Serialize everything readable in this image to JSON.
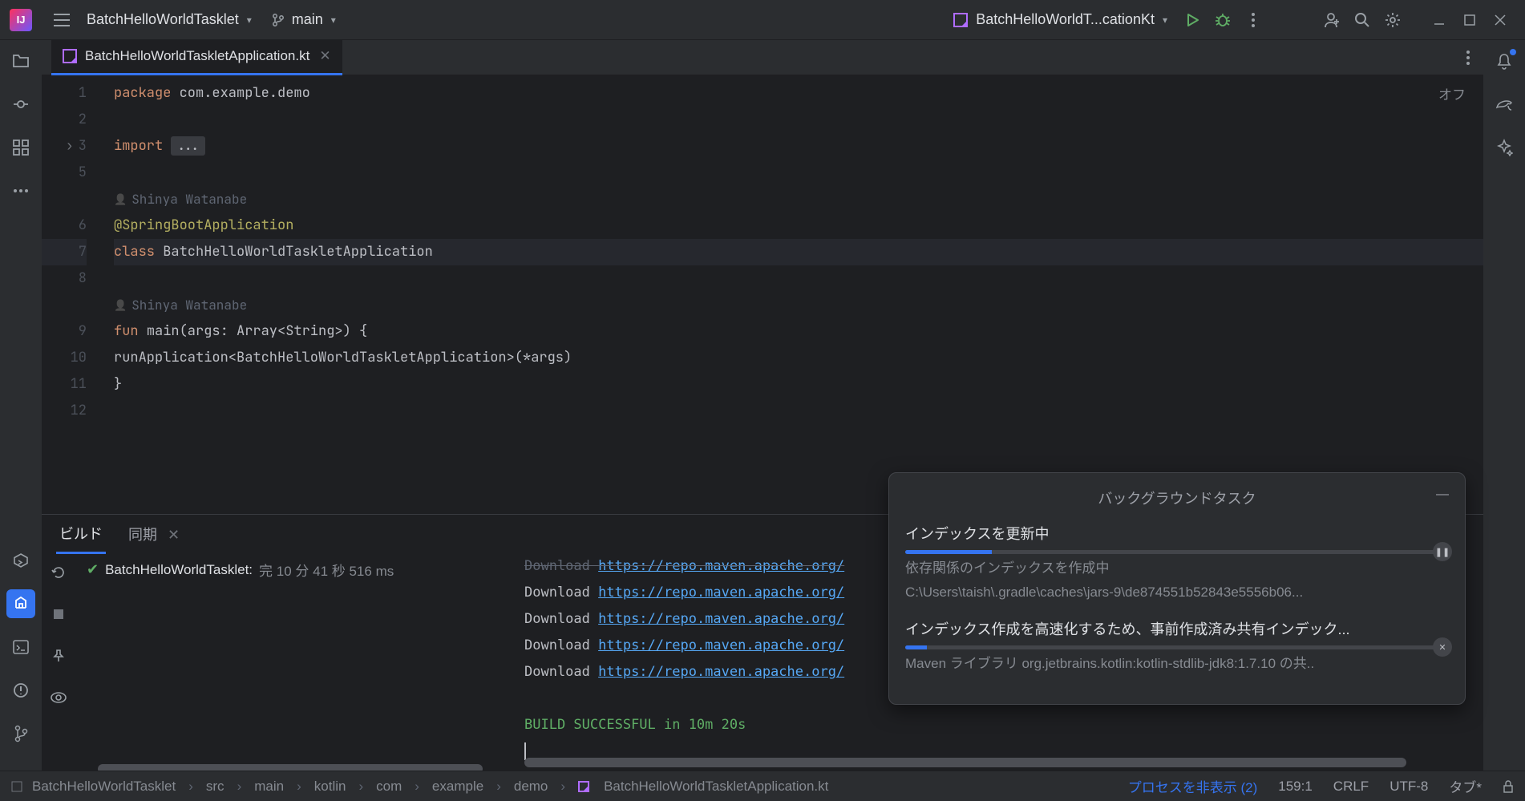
{
  "topbar": {
    "project": "BatchHelloWorldTasklet",
    "branch": "main",
    "run_config": "BatchHelloWorldT...cationKt"
  },
  "tab": {
    "filename": "BatchHelloWorldTaskletApplication.kt"
  },
  "editor": {
    "off": "オフ",
    "lines": {
      "l1": "1",
      "l2": "2",
      "l3": "3",
      "l5": "5",
      "l6": "6",
      "l7": "7",
      "l8": "8",
      "l9": "9",
      "l10": "10",
      "l11": "11",
      "l12": "12"
    },
    "code": {
      "pkg_kw": "package ",
      "pkg_name": "com.example.demo",
      "import_kw": "import ",
      "import_fold": "...",
      "author": "Shinya Watanabe",
      "annotation": "@SpringBootApplication",
      "class_kw": "class ",
      "class_name": "BatchHelloWorldTaskletApplication",
      "fun_kw": "fun ",
      "main_sig": "main(args: Array<String>) {",
      "run_call": "    runApplication<BatchHelloWorldTaskletApplication>(*args)",
      "close_brace": "}"
    }
  },
  "panel": {
    "tab_build": "ビルド",
    "tab_sync": "同期",
    "build_item": "BatchHelloWorldTasklet:",
    "build_status_prefix": "完",
    "build_time": "10 分 41 秒 516 ms",
    "console_lines": [
      "Download https://repo.maven.apache.org/",
      "Download https://repo.maven.apache.org/",
      "Download https://repo.maven.apache.org/",
      "Download https://repo.maven.apache.org/",
      "Download https://repo.maven.apache.org/"
    ],
    "build_success": "BUILD SUCCESSFUL in 10m 20s"
  },
  "bg_tasks": {
    "title": "バックグラウンドタスク",
    "task1": {
      "title": "インデックスを更新中",
      "desc1": "依存関係のインデックスを作成中",
      "desc2": "C:\\Users\\taish\\.gradle\\caches\\jars-9\\de874551b52843e5556b06...",
      "progress": 16
    },
    "task2": {
      "title": "インデックス作成を高速化するため、事前作成済み共有インデック...",
      "desc": "Maven ライブラリ org.jetbrains.kotlin:kotlin-stdlib-jdk8:1.7.10 の共..",
      "progress": 4
    }
  },
  "breadcrumbs": [
    "BatchHelloWorldTasklet",
    "src",
    "main",
    "kotlin",
    "com",
    "example",
    "demo",
    "BatchHelloWorldTaskletApplication.kt"
  ],
  "status": {
    "process_hide": "プロセスを非表示 (2)",
    "pos": "159:1",
    "eol": "CRLF",
    "enc": "UTF-8",
    "tab": "タブ*"
  }
}
